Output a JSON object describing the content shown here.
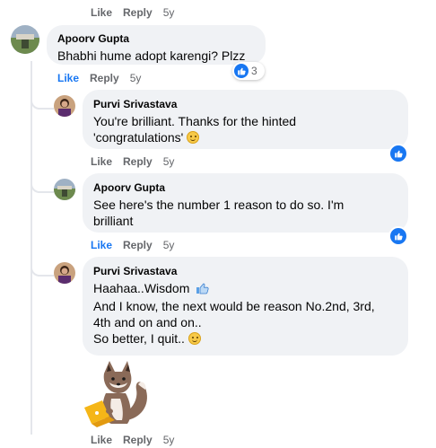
{
  "top_actions": {
    "like": "Like",
    "reply": "Reply",
    "time": "5y"
  },
  "comments": [
    {
      "author": "Apoorv Gupta",
      "lines": [
        "Bhabhi hume adopt karengi? Plzz"
      ],
      "like": "Like",
      "reply": "Reply",
      "time": "5y",
      "liked": true,
      "reaction_count": "3"
    },
    {
      "author": "Purvi Srivastava",
      "lines": [
        "You're brilliant. Thanks for the hinted",
        "'congratulations'"
      ],
      "like": "Like",
      "reply": "Reply",
      "time": "5y",
      "liked": false
    },
    {
      "author": "Apoorv Gupta",
      "lines": [
        "See here's the number 1 reason to do so. I'm",
        "brilliant"
      ],
      "like": "Like",
      "reply": "Reply",
      "time": "5y",
      "liked": true
    },
    {
      "author": "Purvi Srivastava",
      "lines": [
        "Haahaa..Wisdom",
        "And I know, the next would be reason No.2nd, 3rd,",
        "4th and on and on..",
        "So better, I quit.."
      ],
      "like": "Like",
      "reply": "Reply",
      "time": "5y",
      "liked": false
    }
  ],
  "colors": {
    "accent": "#1877f2",
    "bubble": "#f0f2f5",
    "meta": "#65676b"
  },
  "icons": [
    "like-icon",
    "smile-emoji-icon",
    "thumbs-up-emoji-icon",
    "fox-sticker"
  ]
}
